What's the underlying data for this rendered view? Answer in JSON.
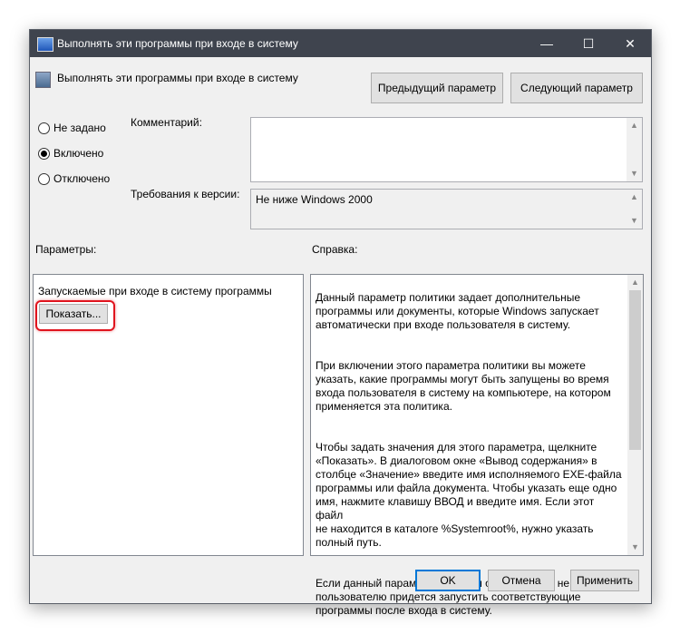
{
  "window": {
    "title": "Выполнять эти программы при входе в систему",
    "minimize": "—",
    "maximize": "☐",
    "close": "✕"
  },
  "header": {
    "policy_name": "Выполнять эти программы при входе в систему",
    "prev_button": "Предыдущий параметр",
    "next_button": "Следующий параметр"
  },
  "state": {
    "options": [
      {
        "label": "Не задано",
        "selected": false
      },
      {
        "label": "Включено",
        "selected": true
      },
      {
        "label": "Отключено",
        "selected": false
      }
    ]
  },
  "comment": {
    "label": "Комментарий:",
    "value": ""
  },
  "version": {
    "label": "Требования к версии:",
    "value": "Не ниже Windows 2000"
  },
  "params": {
    "label": "Параметры:",
    "item_label": "Запускаемые при входе в систему программы",
    "show_button": "Показать..."
  },
  "help": {
    "label": "Справка:",
    "paragraphs": [
      "Данный параметр политики задает дополнительные\nпрограммы или документы, которые Windows запускает\nавтоматически при входе пользователя в систему.",
      "При включении этого параметра политики вы можете\nуказать, какие программы могут быть запущены во время\nвхода пользователя в систему на компьютере, на котором\nприменяется эта политика.",
      "Чтобы задать значения для этого параметра, щелкните\n«Показать». В диалоговом окне «Вывод содержания» в\nстолбце «Значение» введите имя исполняемого EXE-файла\nпрограммы или файла документа. Чтобы указать еще одно\nимя, нажмите клавишу ВВОД и введите имя. Если этот файл\nне находится в каталоге %Systemroot%, нужно указать\nполный путь.",
      "Если данный параметр политики отключен или не настроен,\nпользователю придется запустить соответствующие\nпрограммы после входа в систему."
    ]
  },
  "footer": {
    "ok": "OK",
    "cancel": "Отмена",
    "apply": "Применить"
  },
  "colors": {
    "highlight": "#e0141e",
    "titlebar": "#3f444e"
  }
}
